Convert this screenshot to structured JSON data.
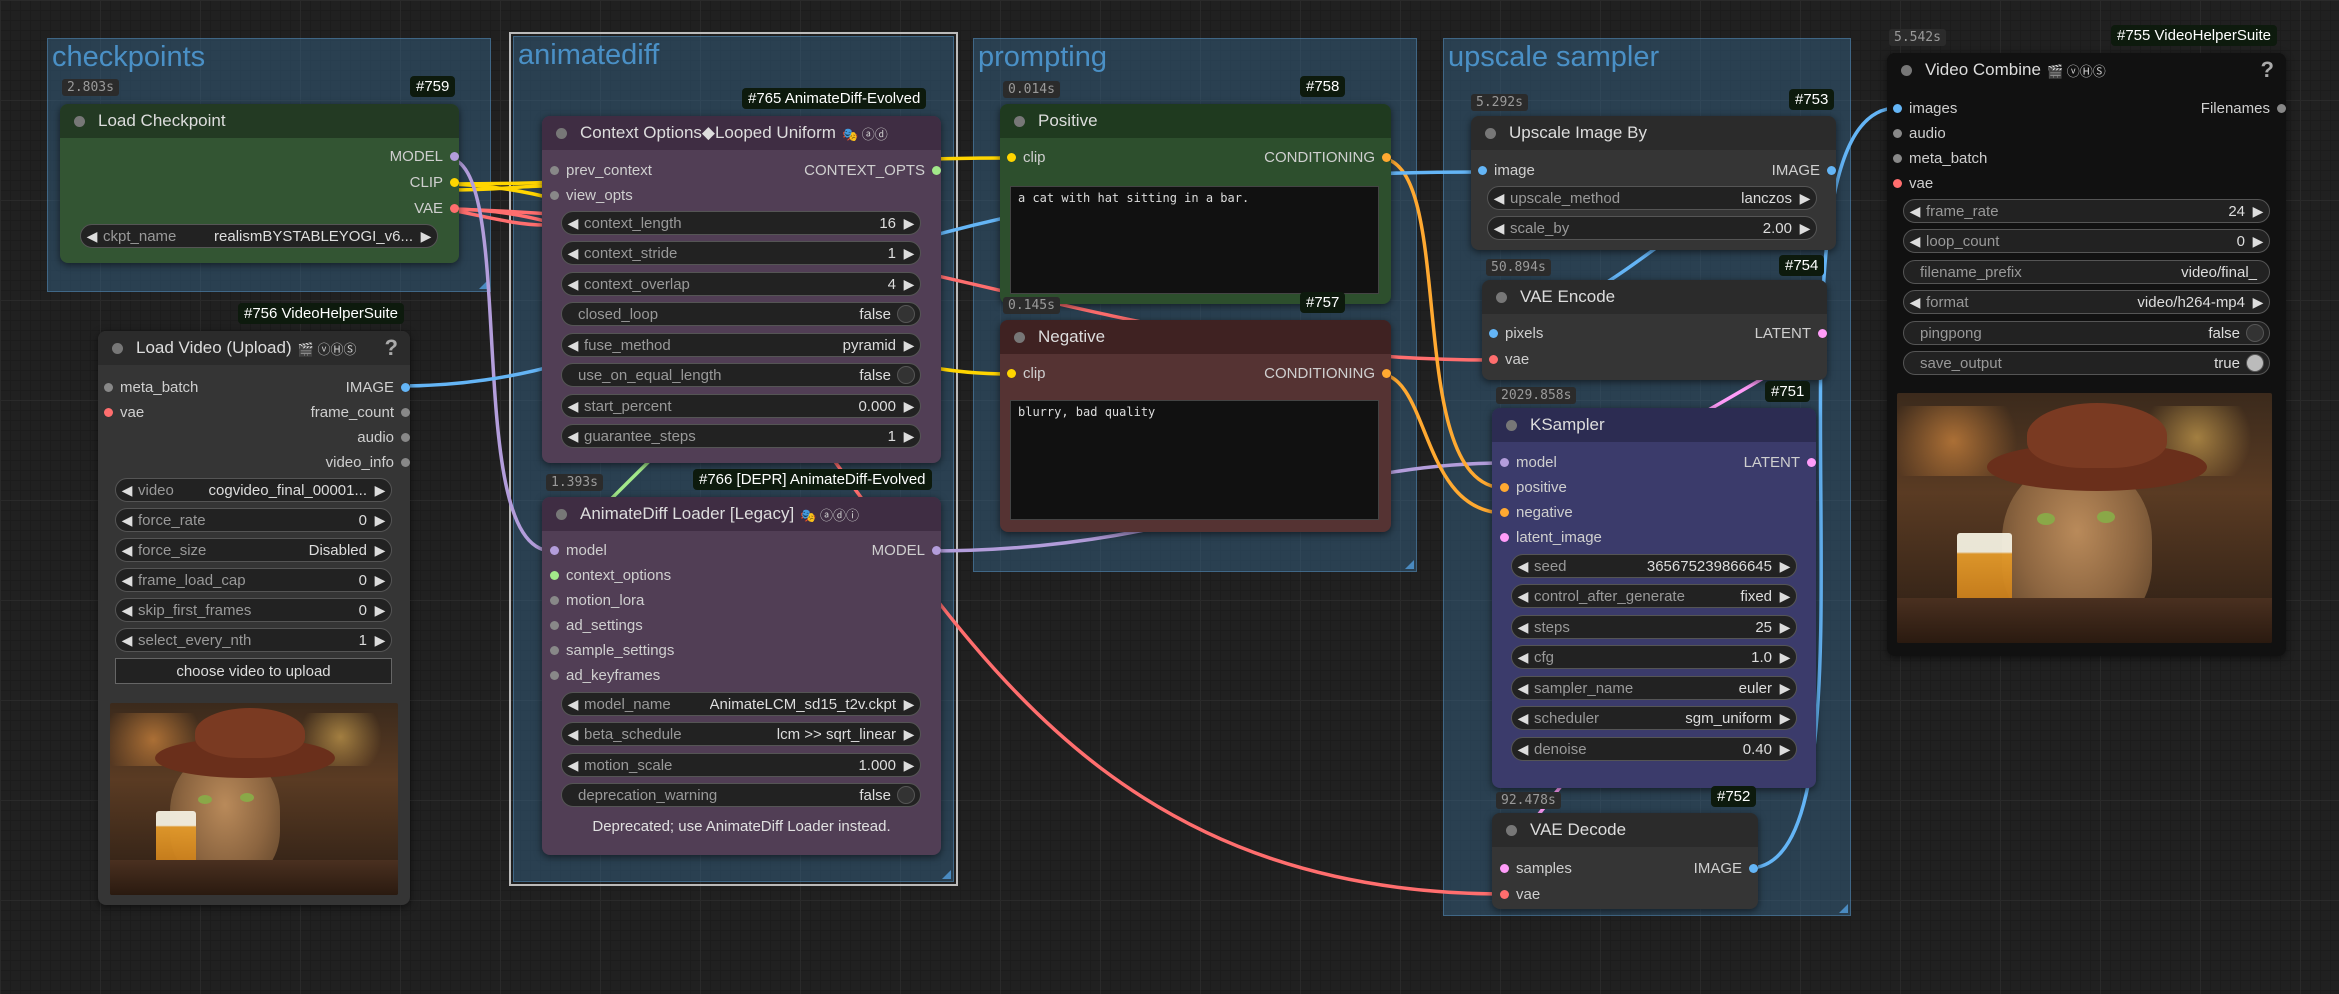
{
  "groups": {
    "checkpoints": "checkpoints",
    "animatediff": "animatediff",
    "prompting": "prompting",
    "upscale": "upscale sampler"
  },
  "load_checkpoint": {
    "title": "Load Checkpoint",
    "id": "#759",
    "timing": "2.803s",
    "outputs": [
      "MODEL",
      "CLIP",
      "VAE"
    ],
    "ckpt_label": "ckpt_name",
    "ckpt_value": "realismBYSTABLEYOGI_v6..."
  },
  "load_video": {
    "title": "Load Video (Upload)",
    "badges": "🎬 ⓥⒽⓈ",
    "help": "?",
    "id": "#756 VideoHelperSuite",
    "inputs": [
      "meta_batch",
      "vae"
    ],
    "outputs": [
      "IMAGE",
      "frame_count",
      "audio",
      "video_info"
    ],
    "widgets": [
      {
        "label": "video",
        "value": "cogvideo_final_00001..."
      },
      {
        "label": "force_rate",
        "value": "0"
      },
      {
        "label": "force_size",
        "value": "Disabled"
      },
      {
        "label": "frame_load_cap",
        "value": "0"
      },
      {
        "label": "skip_first_frames",
        "value": "0"
      },
      {
        "label": "select_every_nth",
        "value": "1"
      }
    ],
    "upload_button": "choose video to upload"
  },
  "context_options": {
    "title": "Context Options◆Looped Uniform",
    "badges": "🎭 ⓐⓓ",
    "id": "#765 AnimateDiff-Evolved",
    "inputs": [
      "prev_context",
      "view_opts"
    ],
    "output": "CONTEXT_OPTS",
    "widgets": [
      {
        "label": "context_length",
        "value": "16"
      },
      {
        "label": "context_stride",
        "value": "1"
      },
      {
        "label": "context_overlap",
        "value": "4"
      }
    ],
    "closed_loop": {
      "label": "closed_loop",
      "value": "false"
    },
    "fuse_method": {
      "label": "fuse_method",
      "value": "pyramid"
    },
    "use_on_equal_length": {
      "label": "use_on_equal_length",
      "value": "false"
    },
    "start_percent": {
      "label": "start_percent",
      "value": "0.000"
    },
    "guarantee_steps": {
      "label": "guarantee_steps",
      "value": "1"
    }
  },
  "animatediff_loader": {
    "title": "AnimateDiff Loader [Legacy]",
    "badges": "🎭 ⓐⓓⓘ",
    "id": "#766 [DEPR] AnimateDiff-Evolved",
    "timing": "1.393s",
    "inputs": [
      "model",
      "context_options",
      "motion_lora",
      "ad_settings",
      "sample_settings",
      "ad_keyframes"
    ],
    "output": "MODEL",
    "widgets": [
      {
        "label": "model_name",
        "value": "AnimateLCM_sd15_t2v.ckpt"
      },
      {
        "label": "beta_schedule",
        "value": "lcm >> sqrt_linear"
      },
      {
        "label": "motion_scale",
        "value": "1.000"
      }
    ],
    "deprecation_warning": {
      "label": "deprecation_warning",
      "value": "false"
    },
    "note": "Deprecated; use AnimateDiff Loader instead."
  },
  "positive": {
    "title": "Positive",
    "id": "#758",
    "timing": "0.014s",
    "input": "clip",
    "output": "CONDITIONING",
    "text": "a cat with hat sitting in a bar."
  },
  "negative": {
    "title": "Negative",
    "id": "#757",
    "timing": "0.145s",
    "input": "clip",
    "output": "CONDITIONING",
    "text": "blurry, bad quality"
  },
  "upscale_image": {
    "title": "Upscale Image By",
    "id": "#753",
    "timing": "5.292s",
    "input": "image",
    "output": "IMAGE",
    "widgets": [
      {
        "label": "upscale_method",
        "value": "lanczos"
      },
      {
        "label": "scale_by",
        "value": "2.00"
      }
    ]
  },
  "vae_encode": {
    "title": "VAE Encode",
    "id": "#754",
    "timing": "50.894s",
    "inputs": [
      "pixels",
      "vae"
    ],
    "output": "LATENT"
  },
  "ksampler": {
    "title": "KSampler",
    "id": "#751",
    "timing": "2029.858s",
    "inputs": [
      "model",
      "positive",
      "negative",
      "latent_image"
    ],
    "output": "LATENT",
    "widgets": [
      {
        "label": "seed",
        "value": "365675239866645"
      },
      {
        "label": "control_after_generate",
        "value": "fixed"
      },
      {
        "label": "steps",
        "value": "25"
      },
      {
        "label": "cfg",
        "value": "1.0"
      },
      {
        "label": "sampler_name",
        "value": "euler"
      },
      {
        "label": "scheduler",
        "value": "sgm_uniform"
      },
      {
        "label": "denoise",
        "value": "0.40"
      }
    ]
  },
  "vae_decode": {
    "title": "VAE Decode",
    "id": "#752",
    "timing": "92.478s",
    "inputs": [
      "samples",
      "vae"
    ],
    "output": "IMAGE"
  },
  "video_combine": {
    "title": "Video Combine",
    "badges": "🎬 ⓥⒽⓈ",
    "help": "?",
    "id": "#755 VideoHelperSuite",
    "timing": "5.542s",
    "inputs": [
      "images",
      "audio",
      "meta_batch",
      "vae"
    ],
    "output": "Filenames",
    "widgets": [
      {
        "label": "frame_rate",
        "value": "24"
      },
      {
        "label": "loop_count",
        "value": "0"
      }
    ],
    "filename_prefix": {
      "label": "filename_prefix",
      "value": "video/final_"
    },
    "format": {
      "label": "format",
      "value": "video/h264-mp4"
    },
    "pingpong": {
      "label": "pingpong",
      "value": "false"
    },
    "save_output": {
      "label": "save_output",
      "value": "true"
    }
  },
  "colors": {
    "model": "#b39ddb",
    "clip": "#ffd500",
    "vae": "#ff6e6e",
    "image": "#64b5f6",
    "latent": "#ff9cf9",
    "conditioning": "#ffa931",
    "context": "#a2e88a"
  }
}
